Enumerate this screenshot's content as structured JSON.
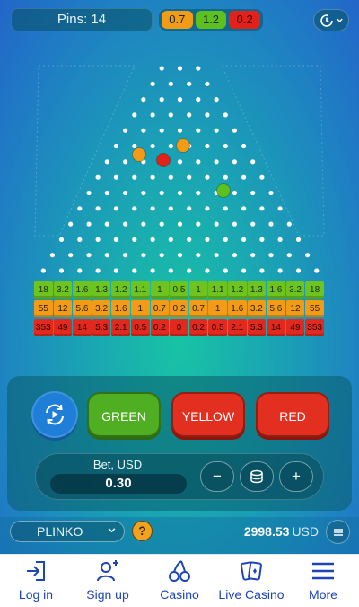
{
  "header": {
    "pins_text": "Pins: 14",
    "risk_levels": [
      "0.7",
      "1.2",
      "0.2"
    ]
  },
  "board": {
    "pin_rows": 14,
    "balls": [
      {
        "color": "#f29b16"
      },
      {
        "color": "#f29b16"
      },
      {
        "color": "#e3211b"
      },
      {
        "color": "#5cc11f"
      }
    ],
    "slots": {
      "green": [
        "18",
        "3.2",
        "1.6",
        "1.3",
        "1.2",
        "1.1",
        "1",
        "0.5",
        "1",
        "1.1",
        "1.2",
        "1.3",
        "1.6",
        "3.2",
        "18"
      ],
      "yellow": [
        "55",
        "12",
        "5.6",
        "3.2",
        "1.6",
        "1",
        "0.7",
        "0.2",
        "0.7",
        "1",
        "1.6",
        "3.2",
        "5.6",
        "12",
        "55"
      ],
      "red": [
        "353",
        "49",
        "14",
        "5.3",
        "2.1",
        "0.5",
        "0.2",
        "0",
        "0.2",
        "0.5",
        "2.1",
        "5.3",
        "14",
        "49",
        "353"
      ]
    }
  },
  "controls": {
    "green_label": "GREEN",
    "yellow_label": "YELLOW",
    "red_label": "RED",
    "bet_label": "Bet, USD",
    "bet_value": "0.30",
    "minus_label": "−",
    "plus_label": "+"
  },
  "footer": {
    "game_name": "PLINKO",
    "help_label": "?",
    "balance_amount": "2998.53",
    "balance_currency": "USD"
  },
  "nav": [
    {
      "label": "Log in",
      "icon": "login-icon"
    },
    {
      "label": "Sign up",
      "icon": "add-user-icon"
    },
    {
      "label": "Casino",
      "icon": "cherries-icon"
    },
    {
      "label": "Live Casino",
      "icon": "cards-icon"
    },
    {
      "label": "More",
      "icon": "menu-icon"
    }
  ],
  "colors": {
    "accent": "#1d44b8",
    "green": "#6ec41f",
    "yellow": "#f29b16",
    "red": "#e12a1d"
  }
}
